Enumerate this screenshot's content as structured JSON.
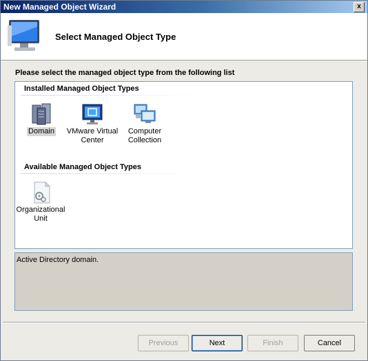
{
  "window": {
    "title": "New Managed Object Wizard",
    "close_glyph": "x"
  },
  "header": {
    "title": "Select Managed Object Type",
    "icon": "monitor-icon"
  },
  "prompt": "Please select the managed object type from the following list",
  "installed": {
    "header": "Installed Managed Object Types",
    "items": [
      {
        "label": "Domain",
        "icon": "server-cluster-icon",
        "selected": true
      },
      {
        "label1": "VMware Virtual",
        "label2": "Center",
        "icon": "vmware-monitor-icon"
      },
      {
        "label1": "Computer",
        "label2": "Collection",
        "icon": "computer-collection-icon"
      }
    ]
  },
  "available": {
    "header": "Available Managed Object Types",
    "items": [
      {
        "label1": "Organizational",
        "label2": "Unit",
        "icon": "document-gear-icon"
      }
    ]
  },
  "description": "Active Directory domain.",
  "buttons": {
    "previous": "Previous",
    "next": "Next",
    "finish": "Finish",
    "cancel": "Cancel"
  }
}
